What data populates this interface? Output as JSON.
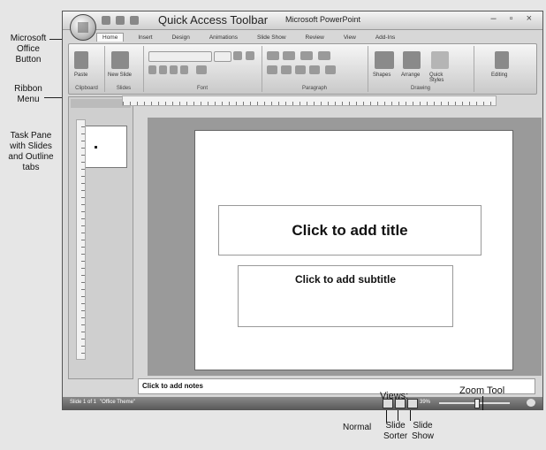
{
  "annotations": {
    "office_button": [
      "Microsoft",
      "Office",
      "Button"
    ],
    "ribbon_menu": [
      "Ribbon",
      "Menu"
    ],
    "task_pane": [
      "Task Pane",
      "with Slides",
      "and Outline",
      "tabs"
    ],
    "qat": "Quick Access Toolbar",
    "views": "Views:",
    "zoom_tool": "Zoom Tool",
    "normal": "Normal",
    "slide_sorter": [
      "Slide",
      "Sorter"
    ],
    "slide_show": [
      "Slide",
      "Show"
    ]
  },
  "window": {
    "title": "Microsoft PowerPoint",
    "controls": "– ▫ ×",
    "tabs": [
      "Home",
      "Insert",
      "Design",
      "Animations",
      "Slide Show",
      "Review",
      "View",
      "Add-Ins"
    ],
    "groups": [
      "Clipboard",
      "Slides",
      "Font",
      "Paragraph",
      "Drawing",
      "Editing"
    ],
    "ribbon_labels": {
      "paste": "Paste",
      "new_slide": "New Slide",
      "shapes": "Shapes",
      "arrange": "Arrange",
      "quick_styles": "Quick Styles",
      "editing": "Editing"
    }
  },
  "slide": {
    "title_placeholder": "Click to add title",
    "subtitle_placeholder": "Click to add subtitle"
  },
  "notes_placeholder": "Click to add notes",
  "status": {
    "slide_count": "Slide 1 of 1",
    "theme": "\"Office Theme\"",
    "zoom": "39%"
  }
}
